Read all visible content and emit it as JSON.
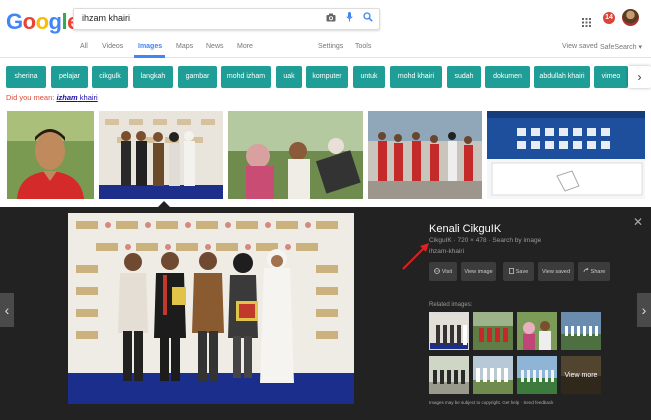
{
  "header": {
    "logo_letters": [
      {
        "ch": "G",
        "color": "#4285f4"
      },
      {
        "ch": "o",
        "color": "#ea4335"
      },
      {
        "ch": "o",
        "color": "#fbbc05"
      },
      {
        "ch": "g",
        "color": "#4285f4"
      },
      {
        "ch": "l",
        "color": "#34a853"
      },
      {
        "ch": "e",
        "color": "#ea4335"
      }
    ],
    "search_value": "ihzam khairi",
    "icons": [
      "camera-icon",
      "mic-icon",
      "search-icon"
    ],
    "notification_count": "14"
  },
  "nav": {
    "tabs": [
      "All",
      "Videos",
      "Images",
      "Maps",
      "News",
      "More"
    ],
    "active": "Images",
    "settings": "Settings",
    "tools": "Tools",
    "view_saved": "View saved",
    "safesearch": "SafeSearch ▾"
  },
  "chips": [
    "sherina",
    "pelajar",
    "cikgulk",
    "langkah",
    "gambar",
    "mohd izham",
    "uak",
    "komputer",
    "untuk",
    "mohd khairi",
    "sudah",
    "dokumen",
    "abdullah khairi",
    "vimeo"
  ],
  "chip_next": "›",
  "did_you_mean": {
    "prefix": "Did you mean: ",
    "bold": "izham",
    "rest": " khairi"
  },
  "panel": {
    "title": "Kenali CikguIK",
    "meta": "CikguIK · 720 × 478 · Search by image",
    "name": "ihzam-khairi",
    "actions": [
      {
        "label": "Visit",
        "icon": "globe-icon"
      },
      {
        "label": "View image",
        "icon": ""
      },
      {
        "label": "Save",
        "icon": "bookmark-icon"
      },
      {
        "label": "View saved",
        "icon": ""
      },
      {
        "label": "Share",
        "icon": "share-icon"
      }
    ],
    "related_label": "Related images:",
    "view_more": "View more",
    "footer_prefix": "Images may be subject to copyright. ",
    "footer_help": "Get help",
    "footer_sep": " · ",
    "footer_feedback": "Send feedback",
    "close": "✕",
    "prev": "‹",
    "next": "›"
  }
}
